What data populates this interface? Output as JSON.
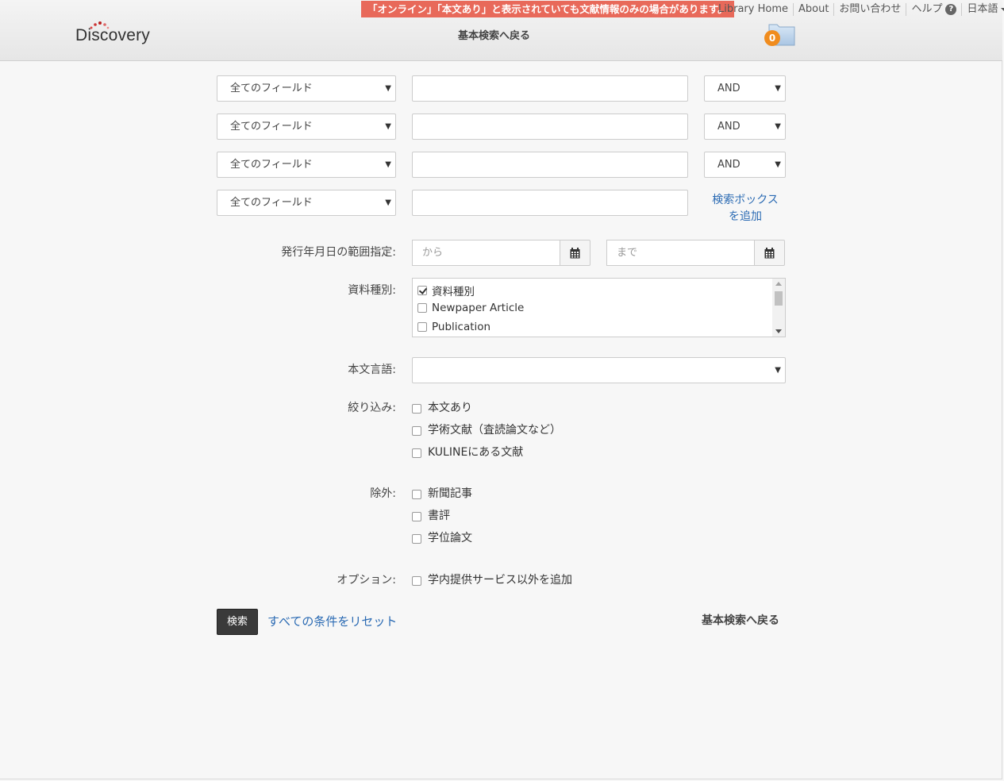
{
  "header": {
    "logo_text": "Discovery",
    "notice": "「オンライン」「本文あり」と表示されていても文献情報のみの場合があります。",
    "links": [
      "Library Home",
      "About",
      "お問い合わせ",
      "ヘルプ",
      "日本語"
    ],
    "help_badge": "?",
    "back_to_basic": "基本検索へ戻る",
    "folder_count": "0",
    "accent_color": "#e8695a",
    "badge_color": "#f08c1e"
  },
  "search_rows": [
    {
      "field": "全てのフィールド",
      "value": "",
      "operator": "AND"
    },
    {
      "field": "全てのフィールド",
      "value": "",
      "operator": "AND"
    },
    {
      "field": "全てのフィールド",
      "value": "",
      "operator": "AND"
    },
    {
      "field": "全てのフィールド",
      "value": ""
    }
  ],
  "add_search_box": [
    "検索ボックス",
    "を追加"
  ],
  "date_range": {
    "label": "発行年月日の範囲指定:",
    "from_placeholder": "から",
    "to_placeholder": "まで"
  },
  "material_type": {
    "label": "資料種別:",
    "options": [
      {
        "text": "資料種別",
        "checked": true
      },
      {
        "text": "Newpaper Article",
        "checked": false
      },
      {
        "text": "Publication",
        "checked": false
      }
    ]
  },
  "language": {
    "label": "本文言語:",
    "value": ""
  },
  "narrow": {
    "label": "絞り込み:",
    "items": [
      "本文あり",
      "学術文献（査読論文など）",
      "KULINEにある文献"
    ]
  },
  "exclude": {
    "label": "除外:",
    "items": [
      "新聞記事",
      "書評",
      "学位論文"
    ]
  },
  "options": {
    "label": "オプション:",
    "items": [
      "学内提供サービス以外を追加"
    ]
  },
  "actions": {
    "search": "検索",
    "reset": "すべての条件をリセット",
    "back_to_basic": "基本検索へ戻る"
  }
}
